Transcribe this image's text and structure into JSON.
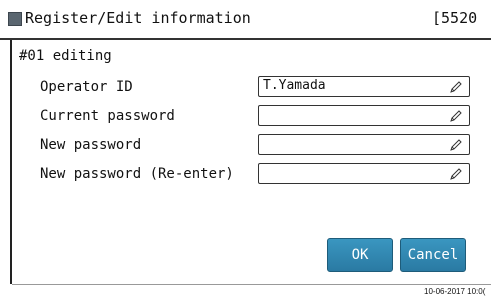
{
  "window": {
    "title": "Register/Edit information",
    "screen_code": "[5520"
  },
  "subtitle": "#01 editing",
  "form": {
    "fields": [
      {
        "label": "Operator ID",
        "value": "T.Yamada"
      },
      {
        "label": "Current password",
        "value": ""
      },
      {
        "label": "New password",
        "value": ""
      },
      {
        "label": "New password (Re-enter)",
        "value": ""
      }
    ]
  },
  "buttons": {
    "ok_label": "OK",
    "cancel_label": "Cancel"
  },
  "footer": {
    "timestamp": "10-06-2017 10:0("
  },
  "colors": {
    "button_blue": "#2a7aa3",
    "title_icon": "#5a6670"
  },
  "icons": {
    "edit": "pencil-icon",
    "title": "window-icon"
  }
}
